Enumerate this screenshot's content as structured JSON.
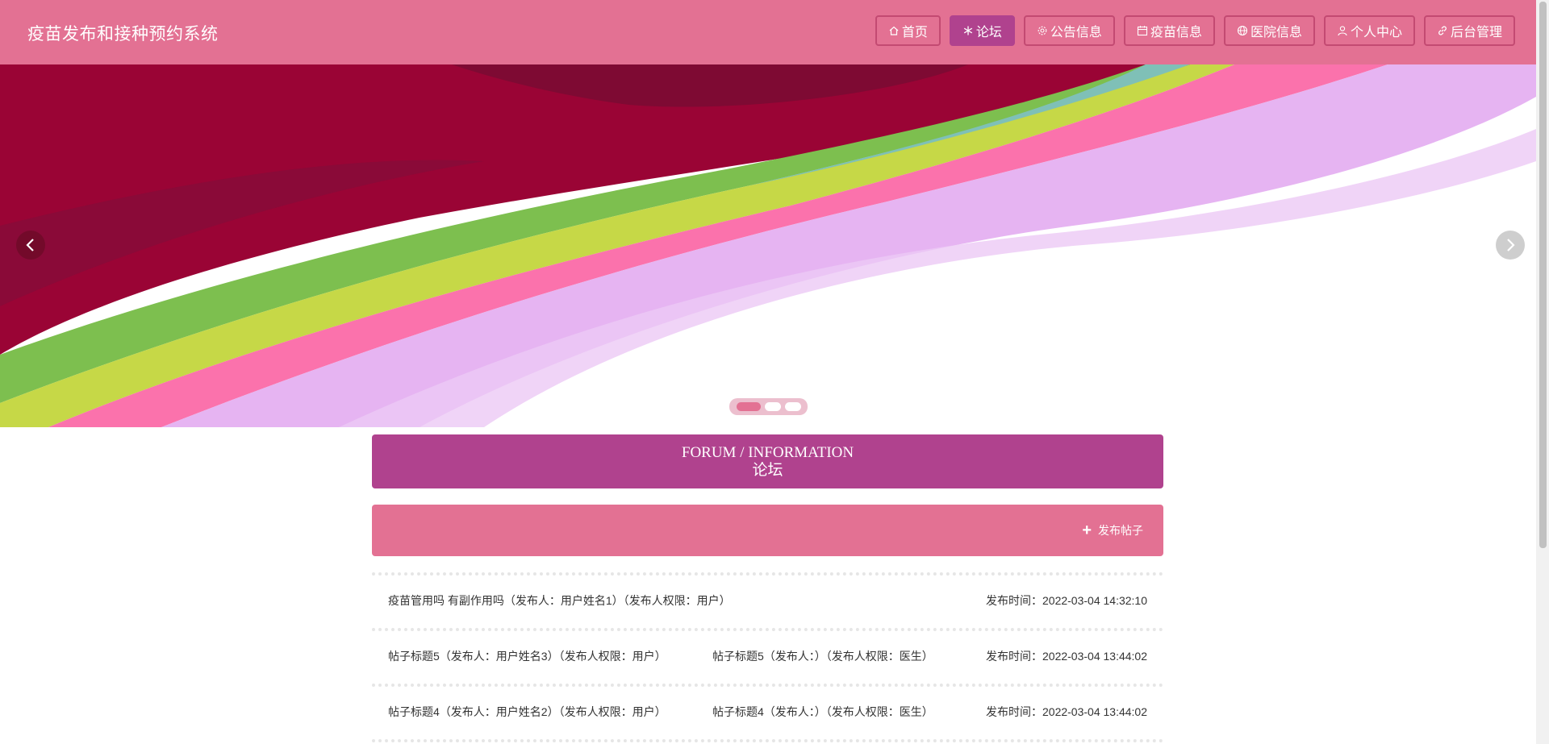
{
  "app": {
    "title": "疫苗发布和接种预约系统"
  },
  "nav": [
    {
      "label": "首页",
      "icon": "home-icon",
      "active": false
    },
    {
      "label": "论坛",
      "icon": "snowflake-icon",
      "active": true
    },
    {
      "label": "公告信息",
      "icon": "gear-icon",
      "active": false
    },
    {
      "label": "疫苗信息",
      "icon": "calendar-icon",
      "active": false
    },
    {
      "label": "医院信息",
      "icon": "globe-icon",
      "active": false
    },
    {
      "label": "个人中心",
      "icon": "user-icon",
      "active": false
    },
    {
      "label": "后台管理",
      "icon": "link-icon",
      "active": false
    }
  ],
  "carousel": {
    "slides": 3,
    "current": 1
  },
  "section": {
    "title_en": "FORUM / INFORMATION",
    "title_cn": "论坛"
  },
  "actions": {
    "post_label": "发布帖子"
  },
  "posts": [
    {
      "col1": "疫苗管用吗 有副作用吗（发布人：用户姓名1）（发布人权限：用户）",
      "col2": "",
      "time": "发布时间：2022-03-04 14:32:10"
    },
    {
      "col1": "帖子标题5（发布人：用户姓名3）（发布人权限：用户）",
      "col2": "帖子标题5（发布人：）（发布人权限：医生）",
      "time": "发布时间：2022-03-04 13:44:02"
    },
    {
      "col1": "帖子标题4（发布人：用户姓名2）（发布人权限：用户）",
      "col2": "帖子标题4（发布人：）（发布人权限：医生）",
      "time": "发布时间：2022-03-04 13:44:02"
    }
  ],
  "colors": {
    "header": "#e37193",
    "accent": "#b0428e",
    "border": "#c34a72"
  }
}
